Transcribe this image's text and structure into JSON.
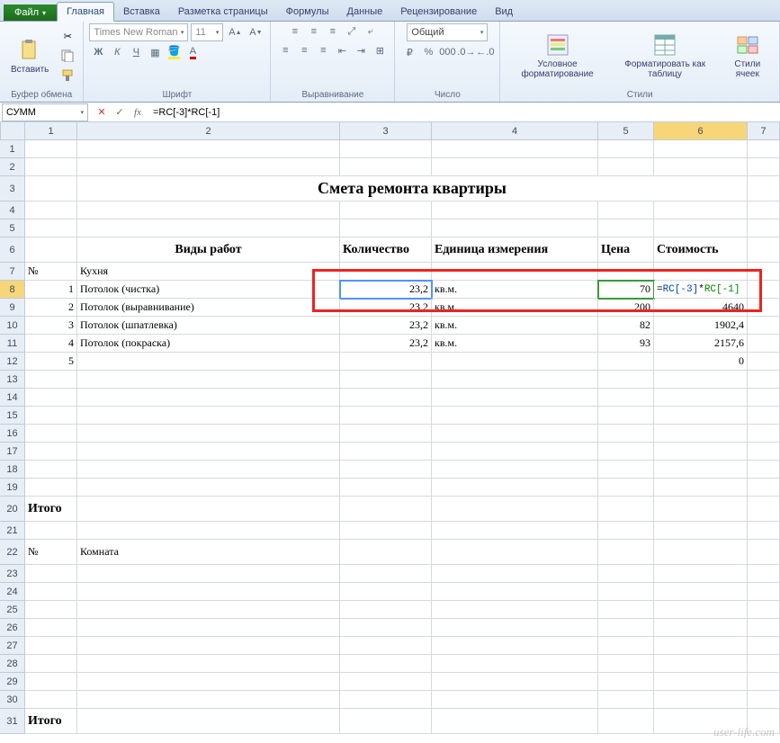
{
  "tabs": {
    "file": "Файл",
    "home": "Главная",
    "insert": "Вставка",
    "layout": "Разметка страницы",
    "formulas": "Формулы",
    "data": "Данные",
    "review": "Рецензирование",
    "view": "Вид"
  },
  "ribbon": {
    "paste": "Вставить",
    "clipboard_group": "Буфер обмена",
    "font_name": "Times New Roman",
    "font_size": "11",
    "font_group": "Шрифт",
    "align_group": "Выравнивание",
    "number_format": "Общий",
    "number_group": "Число",
    "cond_fmt": "Условное форматирование",
    "fmt_table": "Форматировать как таблицу",
    "cell_styles": "Стили ячеек",
    "styles_group": "Стили"
  },
  "formula_bar": {
    "name_box": "СУММ",
    "formula": "=RC[-3]*RC[-1]"
  },
  "columns": [
    "1",
    "2",
    "3",
    "4",
    "5",
    "6",
    "7"
  ],
  "sheet": {
    "title": "Смета ремонта квартиры",
    "h_types": "Виды работ",
    "h_qty": "Количество",
    "h_unit": "Единица измерения",
    "h_price": "Цена",
    "h_cost": "Стоимость",
    "num": "№",
    "kitchen": "Кухня",
    "room": "Комната",
    "total": "Итого",
    "rows": [
      {
        "n": "1",
        "name": "Потолок (чистка)",
        "qty": "23,2",
        "unit": "кв.м.",
        "price": "70",
        "cost": "=RC[-3]*RC[-1]"
      },
      {
        "n": "2",
        "name": "Потолок (выравнивание)",
        "qty": "23,2",
        "unit": "кв.м.",
        "price": "200",
        "cost": "4640"
      },
      {
        "n": "3",
        "name": "Потолок (шпатлевка)",
        "qty": "23,2",
        "unit": "кв.м.",
        "price": "82",
        "cost": "1902,4"
      },
      {
        "n": "4",
        "name": "Потолок (покраска)",
        "qty": "23,2",
        "unit": "кв.м.",
        "price": "93",
        "cost": "2157,6"
      },
      {
        "n": "5",
        "name": "",
        "qty": "",
        "unit": "",
        "price": "",
        "cost": "0"
      }
    ]
  },
  "watermark": "user-life.com"
}
